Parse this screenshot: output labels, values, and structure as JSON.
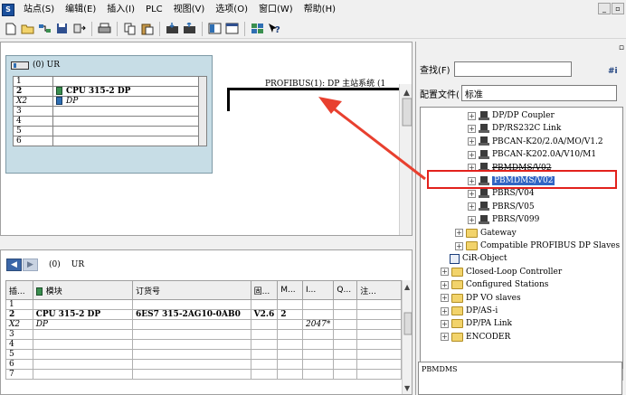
{
  "menu": {
    "items": [
      "站点(S)",
      "编辑(E)",
      "插入(I)",
      "PLC",
      "视图(V)",
      "选项(O)",
      "窗口(W)",
      "帮助(H)"
    ]
  },
  "toolbar": {
    "icons": [
      "new-icon",
      "open-icon",
      "network-icon",
      "save-icon",
      "compile-icon",
      "print-icon",
      "copy-icon",
      "paste-icon",
      "download-icon",
      "upload-icon",
      "overview-icon",
      "window-icon",
      "catalog-icon",
      "help-icon"
    ]
  },
  "station": {
    "rack_title": "(0) UR",
    "rack_rows": [
      {
        "slot": "1",
        "module": ""
      },
      {
        "slot": "2",
        "module": "CPU 315-2 DP"
      },
      {
        "slot": "X2",
        "module": "DP"
      },
      {
        "slot": "3",
        "module": ""
      },
      {
        "slot": "4",
        "module": ""
      },
      {
        "slot": "5",
        "module": ""
      },
      {
        "slot": "6",
        "module": ""
      }
    ],
    "profibus_label": "PROFIBUS(1): DP 主站系统 (1"
  },
  "detail": {
    "rack_id": "(0)",
    "rack_name": "UR",
    "headers": {
      "slot": "插...",
      "module": "模块",
      "order": "订货号",
      "firmware": "固...",
      "mpi": "M...",
      "i_addr": "I...",
      "q_addr": "Q...",
      "comment": "注..."
    },
    "rows": [
      {
        "slot": "1",
        "module": "",
        "order": "",
        "firmware": "",
        "mpi": "",
        "i_addr": "",
        "q_addr": "",
        "comment": ""
      },
      {
        "slot": "2",
        "module": "CPU 315-2 DP",
        "order": "6ES7 315-2AG10-0AB0",
        "firmware": "V2.6",
        "mpi": "2",
        "i_addr": "",
        "q_addr": "",
        "comment": ""
      },
      {
        "slot": "X2",
        "module": "DP",
        "order": "",
        "firmware": "",
        "mpi": "",
        "i_addr": "2047*",
        "q_addr": "",
        "comment": ""
      },
      {
        "slot": "3",
        "module": "",
        "order": "",
        "firmware": "",
        "mpi": "",
        "i_addr": "",
        "q_addr": "",
        "comment": ""
      },
      {
        "slot": "4",
        "module": "",
        "order": "",
        "firmware": "",
        "mpi": "",
        "i_addr": "",
        "q_addr": "",
        "comment": ""
      },
      {
        "slot": "5",
        "module": "",
        "order": "",
        "firmware": "",
        "mpi": "",
        "i_addr": "",
        "q_addr": "",
        "comment": ""
      },
      {
        "slot": "6",
        "module": "",
        "order": "",
        "firmware": "",
        "mpi": "",
        "i_addr": "",
        "q_addr": "",
        "comment": ""
      },
      {
        "slot": "7",
        "module": "",
        "order": "",
        "firmware": "",
        "mpi": "",
        "i_addr": "",
        "q_addr": "",
        "comment": ""
      }
    ]
  },
  "catalog": {
    "find_label": "查找(F)",
    "find_value": "",
    "profile_label": "配置文件(",
    "profile_value": "标准",
    "tree": [
      {
        "label": "DP/DP Coupler",
        "type": "device"
      },
      {
        "label": "DP/RS232C Link",
        "type": "device"
      },
      {
        "label": "PBCAN-K20/2.0A/MO/V1.2",
        "type": "device"
      },
      {
        "label": "PBCAN-K202.0A/V10/M1",
        "type": "device"
      },
      {
        "label": "PBMDMS/V02",
        "type": "device"
      },
      {
        "label": "PBMDMS/V02",
        "type": "device"
      },
      {
        "label": "PBRS/V04",
        "type": "device"
      },
      {
        "label": "PBRS/V05",
        "type": "device"
      },
      {
        "label": "PBRS/V099",
        "type": "device"
      },
      {
        "label": "Gateway",
        "type": "folder"
      },
      {
        "label": "Compatible PROFIBUS DP Slaves",
        "type": "folder"
      },
      {
        "label": "CiR-Object",
        "type": "cir"
      },
      {
        "label": "Closed-Loop Controller",
        "type": "folder"
      },
      {
        "label": "Configured Stations",
        "type": "folder"
      },
      {
        "label": "DP VO slaves",
        "type": "folder"
      },
      {
        "label": "DP/AS-i",
        "type": "folder"
      },
      {
        "label": "DP/PA Link",
        "type": "folder"
      },
      {
        "label": "ENCODER",
        "type": "folder"
      }
    ],
    "info_text": "PBMDMS"
  },
  "colors": {
    "highlight": "#e2211c",
    "arrow": "#e8402f",
    "rack_bg": "#c7dde6"
  }
}
